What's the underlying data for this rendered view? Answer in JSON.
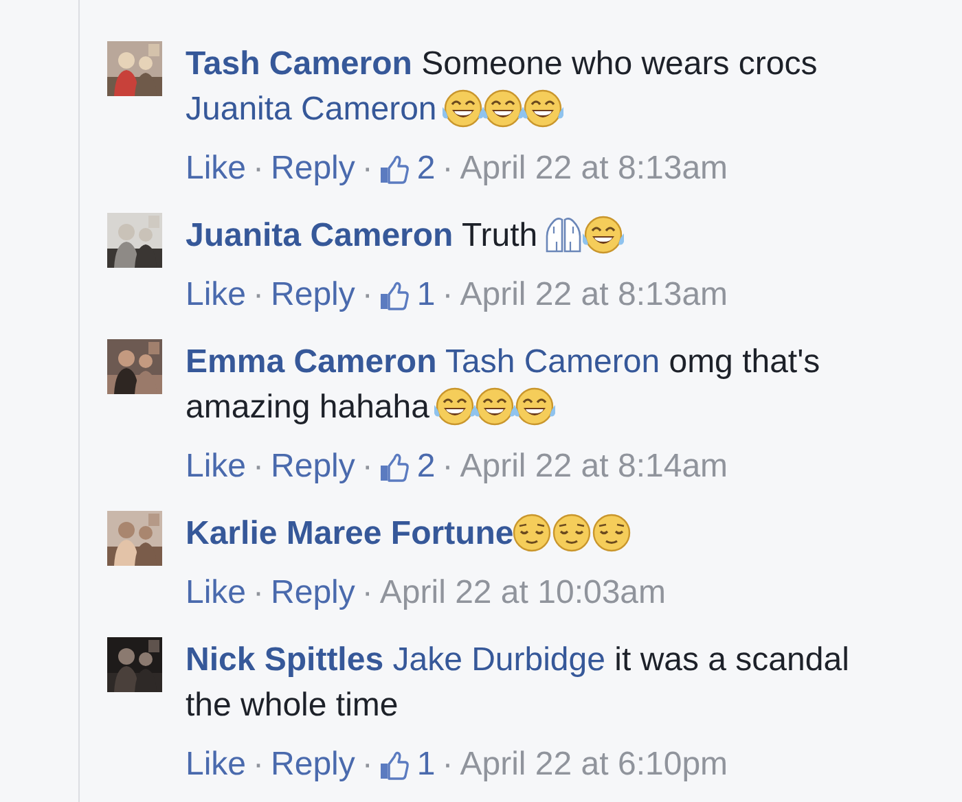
{
  "comments": [
    {
      "author": "Tash Cameron",
      "segments": [
        {
          "kind": "text",
          "text": "Someone who wears crocs"
        },
        {
          "kind": "mention",
          "text": "Juanita Cameron"
        },
        {
          "kind": "tears-of-joy"
        },
        {
          "kind": "tears-of-joy"
        },
        {
          "kind": "tears-of-joy"
        }
      ],
      "actions": [
        {
          "kind": "link",
          "label": "Like"
        },
        {
          "kind": "separator",
          "label": "·"
        },
        {
          "kind": "link",
          "label": "Reply"
        },
        {
          "kind": "separator",
          "label": "·"
        },
        {
          "kind": "likes",
          "label": "2"
        },
        {
          "kind": "separator",
          "label": "·"
        },
        {
          "kind": "time",
          "label": "April 22 at 8:13am"
        }
      ]
    },
    {
      "author": "Juanita Cameron",
      "segments": [
        {
          "kind": "text",
          "text": "Truth"
        },
        {
          "kind": "praying-hands"
        },
        {
          "kind": "tears-of-joy"
        }
      ],
      "actions": [
        {
          "kind": "link",
          "label": "Like"
        },
        {
          "kind": "separator",
          "label": "·"
        },
        {
          "kind": "link",
          "label": "Reply"
        },
        {
          "kind": "separator",
          "label": "·"
        },
        {
          "kind": "likes",
          "label": "1"
        },
        {
          "kind": "separator",
          "label": "·"
        },
        {
          "kind": "time",
          "label": "April 22 at 8:13am"
        }
      ]
    },
    {
      "author": "Emma Cameron",
      "segments": [
        {
          "kind": "mention",
          "text": "Tash Cameron"
        },
        {
          "kind": "text",
          "text": "omg that's amazing hahaha"
        },
        {
          "kind": "tears-of-joy"
        },
        {
          "kind": "tears-of-joy"
        },
        {
          "kind": "tears-of-joy"
        }
      ],
      "actions": [
        {
          "kind": "link",
          "label": "Like"
        },
        {
          "kind": "separator",
          "label": "·"
        },
        {
          "kind": "link",
          "label": "Reply"
        },
        {
          "kind": "separator",
          "label": "·"
        },
        {
          "kind": "likes",
          "label": "2"
        },
        {
          "kind": "separator",
          "label": "·"
        },
        {
          "kind": "time",
          "label": "April 22 at 8:14am"
        }
      ]
    },
    {
      "author": "Karlie Maree Fortune",
      "segments": [
        {
          "kind": "relieved-face"
        },
        {
          "kind": "relieved-face"
        },
        {
          "kind": "relieved-face"
        }
      ],
      "actions": [
        {
          "kind": "link",
          "label": "Like"
        },
        {
          "kind": "separator",
          "label": "·"
        },
        {
          "kind": "link",
          "label": "Reply"
        },
        {
          "kind": "separator",
          "label": "·"
        },
        {
          "kind": "time",
          "label": "April 22 at 10:03am"
        }
      ]
    },
    {
      "author": "Nick Spittles",
      "segments": [
        {
          "kind": "mention",
          "text": "Jake Durbidge"
        },
        {
          "kind": "text",
          "text": "it was a scandal the whole time"
        }
      ],
      "actions": [
        {
          "kind": "link",
          "label": "Like"
        },
        {
          "kind": "separator",
          "label": "·"
        },
        {
          "kind": "link",
          "label": "Reply"
        },
        {
          "kind": "separator",
          "label": "·"
        },
        {
          "kind": "likes",
          "label": "1"
        },
        {
          "kind": "separator",
          "label": "·"
        },
        {
          "kind": "time",
          "label": "April 22 at 6:10pm"
        }
      ]
    }
  ]
}
